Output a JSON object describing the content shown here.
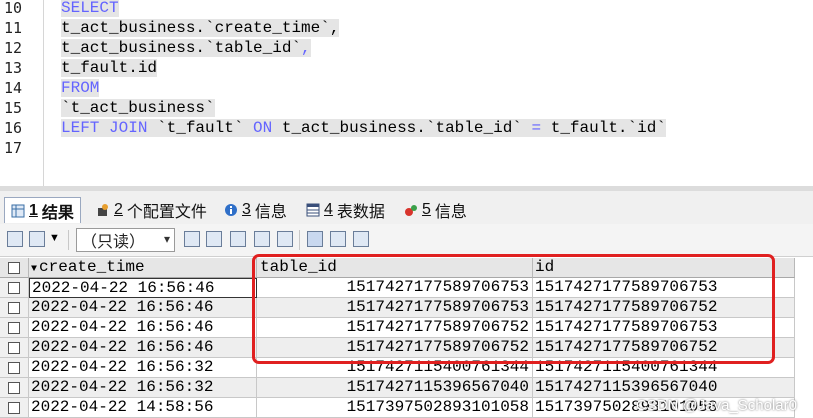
{
  "editor": {
    "lines": [
      {
        "num": "10",
        "parts": [
          {
            "t": "SELECT",
            "c": "kw"
          }
        ]
      },
      {
        "num": "11",
        "parts": [
          {
            "t": "t_act_business.`create_time`,",
            "c": ""
          }
        ]
      },
      {
        "num": "12",
        "parts": [
          {
            "t": "t_act_business.`table_id`",
            "c": ""
          },
          {
            "t": ",",
            "c": "op"
          }
        ]
      },
      {
        "num": "13",
        "parts": [
          {
            "t": "t_fault.id",
            "c": ""
          }
        ]
      },
      {
        "num": "14",
        "parts": [
          {
            "t": "FROM",
            "c": "kw"
          }
        ]
      },
      {
        "num": "15",
        "parts": [
          {
            "t": "`t_act_business`",
            "c": ""
          }
        ]
      },
      {
        "num": "16",
        "parts": [
          {
            "t": "LEFT JOIN",
            "c": "kw"
          },
          {
            "t": " `t_fault` ",
            "c": ""
          },
          {
            "t": "ON",
            "c": "kw"
          },
          {
            "t": " t_act_business.`table_id` ",
            "c": ""
          },
          {
            "t": "=",
            "c": "op"
          },
          {
            "t": " t_fault.`id`",
            "c": ""
          }
        ]
      },
      {
        "num": "17",
        "parts": []
      }
    ]
  },
  "tabs": [
    {
      "num": "1",
      "label": " 结果",
      "icon": "result-grid-icon",
      "active": true
    },
    {
      "num": "2",
      "label": " 个配置文件",
      "icon": "profile-icon",
      "active": false
    },
    {
      "num": "3",
      "label": " 信息",
      "icon": "info-icon",
      "active": false
    },
    {
      "num": "4",
      "label": " 表数据",
      "icon": "table-data-icon",
      "active": false
    },
    {
      "num": "5",
      "label": " 信息",
      "icon": "info2-icon",
      "active": false
    }
  ],
  "toolbar": {
    "readonly_label": "（只读）",
    "chevron": "▾"
  },
  "grid": {
    "columns": [
      "create_time",
      "table_id",
      "id"
    ],
    "rows": [
      [
        "2022-04-22 16:56:46",
        "1517427177589706753",
        "1517427177589706753"
      ],
      [
        "2022-04-22 16:56:46",
        "1517427177589706753",
        "1517427177589706752"
      ],
      [
        "2022-04-22 16:56:46",
        "1517427177589706752",
        "1517427177589706753"
      ],
      [
        "2022-04-22 16:56:46",
        "1517427177589706752",
        "1517427177589706752"
      ],
      [
        "2022-04-22 16:56:32",
        "1517427115400761344",
        "1517427115400761344"
      ],
      [
        "2022-04-22 16:56:32",
        "1517427115396567040",
        "1517427115396567040"
      ],
      [
        "2022-04-22 14:58:56",
        "1517397502893101058",
        "1517397502893101058"
      ]
    ]
  },
  "watermark": "CSDN @Java_Scholar0",
  "colors": {
    "keyword": "#6464ff",
    "annotation": "#e02020"
  }
}
